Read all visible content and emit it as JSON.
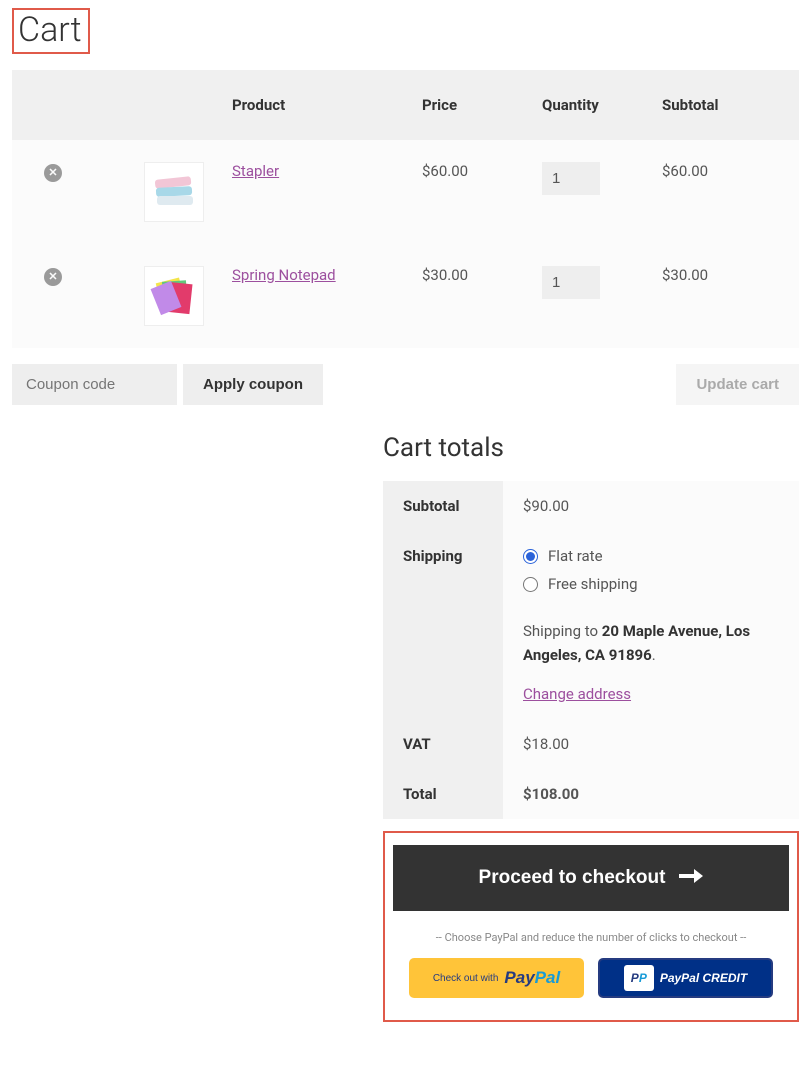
{
  "page_title": "Cart",
  "columns": {
    "product": "Product",
    "price": "Price",
    "qty": "Quantity",
    "subtotal": "Subtotal"
  },
  "items": [
    {
      "name": "Stapler",
      "price": "$60.00",
      "qty": "1",
      "subtotal": "$60.00"
    },
    {
      "name": "Spring Notepad",
      "price": "$30.00",
      "qty": "1",
      "subtotal": "$30.00"
    }
  ],
  "coupon_placeholder": "Coupon code",
  "apply_coupon_label": "Apply coupon",
  "update_cart_label": "Update cart",
  "totals": {
    "heading": "Cart totals",
    "subtotal_label": "Subtotal",
    "subtotal_value": "$90.00",
    "shipping_label": "Shipping",
    "shipping_options": [
      {
        "label": "Flat rate",
        "checked": true
      },
      {
        "label": "Free shipping",
        "checked": false
      }
    ],
    "shipping_to_prefix": "Shipping to ",
    "shipping_to_address": "20 Maple Avenue, Los Angeles, CA 91896",
    "shipping_to_suffix": ".",
    "change_address_label": "Change address",
    "vat_label": "VAT",
    "vat_value": "$18.00",
    "total_label": "Total",
    "total_value": "$108.00"
  },
  "checkout_label": "Proceed to checkout",
  "paypal_hint": "-- Choose PayPal and reduce the number of clicks to checkout --",
  "paypal_checkout_prefix": "Check out with",
  "paypal_credit_label": "PayPal CREDIT"
}
